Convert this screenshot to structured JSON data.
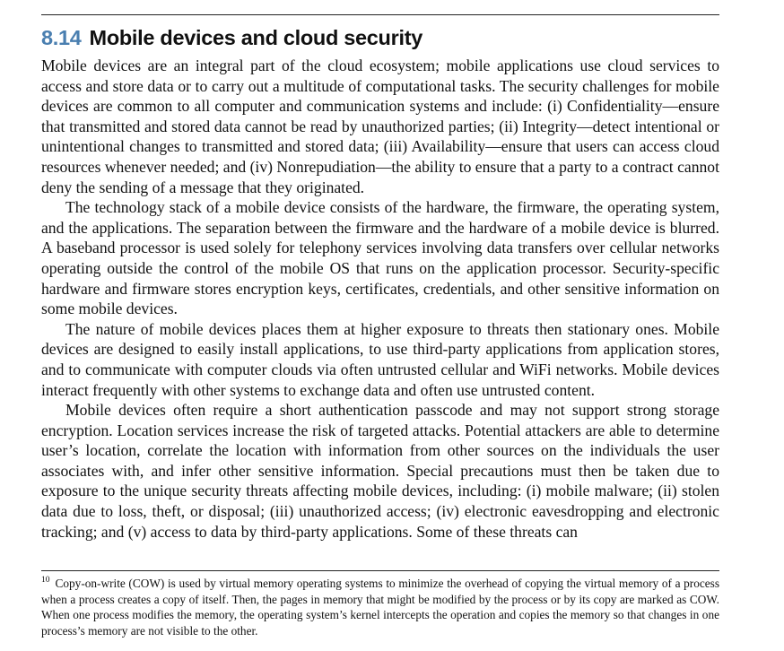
{
  "section": {
    "number": "8.14",
    "title": "Mobile devices and cloud security"
  },
  "paragraphs": [
    "Mobile devices are an integral part of the cloud ecosystem; mobile applications use cloud services to access and store data or to carry out a multitude of computational tasks. The security challenges for mobile devices are common to all computer and communication systems and include: (i) Confidentiality—ensure that transmitted and stored data cannot be read by unauthorized parties; (ii) Integrity—detect intentional or unintentional changes to transmitted and stored data; (iii) Availability—ensure that users can access cloud resources whenever needed; and (iv) Nonrepudiation—the ability to ensure that a party to a contract cannot deny the sending of a message that they originated.",
    "The technology stack of a mobile device consists of the hardware, the firmware, the operating system, and the applications. The separation between the firmware and the hardware of a mobile device is blurred. A baseband processor is used solely for telephony services involving data transfers over cellular networks operating outside the control of the mobile OS that runs on the application processor. Security-specific hardware and firmware stores encryption keys, certificates, credentials, and other sensitive information on some mobile devices.",
    "The nature of mobile devices places them at higher exposure to threats then stationary ones. Mobile devices are designed to easily install applications, to use third-party applications from application stores, and to communicate with computer clouds via often untrusted cellular and WiFi networks. Mobile devices interact frequently with other systems to exchange data and often use untrusted content.",
    "Mobile devices often require a short authentication passcode and may not support strong storage encryption. Location services increase the risk of targeted attacks. Potential attackers are able to determine user’s location, correlate the location with information from other sources on the individuals the user associates with, and infer other sensitive information. Special precautions must then be taken due to exposure to the unique security threats affecting mobile devices, including: (i) mobile malware; (ii) stolen data due to loss, theft, or disposal; (iii) unauthorized access; (iv) electronic eavesdropping and electronic tracking; and (v) access to data by third-party applications. Some of these threats can"
  ],
  "footnote": {
    "marker": "10",
    "text": "Copy-on-write (COW) is used by virtual memory operating systems to minimize the overhead of copying the virtual memory of a process when a process creates a copy of itself. Then, the pages in memory that might be modified by the process or by its copy are marked as COW. When one process modifies the memory, the operating system’s kernel intercepts the operation and copies the memory so that changes in one process’s memory are not visible to the other."
  }
}
